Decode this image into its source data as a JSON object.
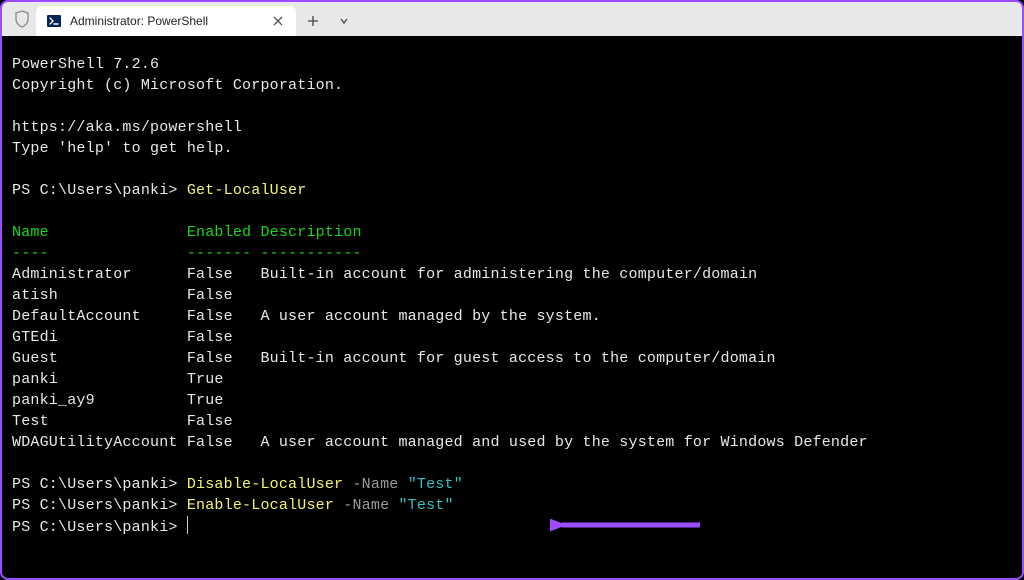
{
  "titlebar": {
    "tab_title": "Administrator: PowerShell"
  },
  "terminal": {
    "version_line": "PowerShell 7.2.6",
    "copyright": "Copyright (c) Microsoft Corporation.",
    "url": "https://aka.ms/powershell",
    "help_hint": "Type 'help' to get help.",
    "prompt": "PS C:\\Users\\panki>",
    "cmd1": "Get-LocalUser",
    "headers": {
      "name": "Name",
      "enabled": "Enabled",
      "description": "Description"
    },
    "dashes": {
      "name": "----",
      "enabled": "-------",
      "description": "-----------"
    },
    "users": [
      {
        "name": "Administrator",
        "enabled": "False",
        "description": "Built-in account for administering the computer/domain"
      },
      {
        "name": "atish",
        "enabled": "False",
        "description": ""
      },
      {
        "name": "DefaultAccount",
        "enabled": "False",
        "description": "A user account managed by the system."
      },
      {
        "name": "GTEdi",
        "enabled": "False",
        "description": ""
      },
      {
        "name": "Guest",
        "enabled": "False",
        "description": "Built-in account for guest access to the computer/domain"
      },
      {
        "name": "panki",
        "enabled": "True",
        "description": ""
      },
      {
        "name": "panki_ay9",
        "enabled": "True",
        "description": ""
      },
      {
        "name": "Test",
        "enabled": "False",
        "description": ""
      },
      {
        "name": "WDAGUtilityAccount",
        "enabled": "False",
        "description": "A user account managed and used by the system for Windows Defender"
      }
    ],
    "cmd2": "Disable-LocalUser",
    "cmd3": "Enable-LocalUser",
    "param_flag": "-Name",
    "param_val": "\"Test\""
  },
  "annotation": {
    "arrow_color": "#9b4dff"
  }
}
